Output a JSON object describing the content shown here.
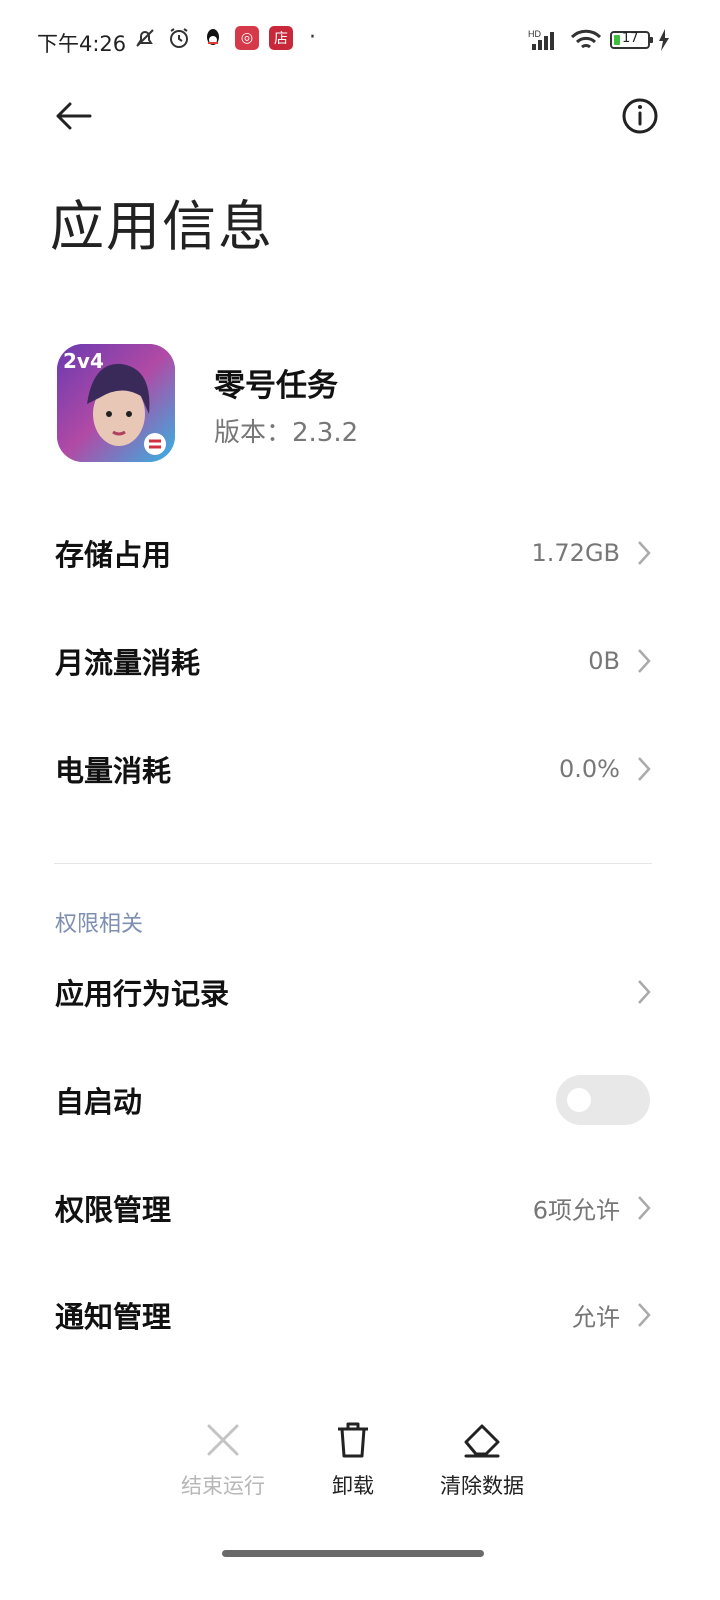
{
  "status_bar": {
    "time": "下午4:26",
    "icons": [
      "mute-bell-icon",
      "alarm-icon",
      "qq-icon",
      "app-badge-icon",
      "store-badge-icon"
    ],
    "store_badge_text": "店",
    "network": "HD",
    "battery_level": "17",
    "charging": true
  },
  "header": {
    "title": "应用信息"
  },
  "app": {
    "name": "零号任务",
    "version": "版本：2.3.2",
    "icon_text": "2v4"
  },
  "rows": {
    "storage": {
      "label": "存储占用",
      "value": "1.72GB"
    },
    "data": {
      "label": "月流量消耗",
      "value": "0B"
    },
    "battery": {
      "label": "电量消耗",
      "value": "0.0%"
    }
  },
  "permissions": {
    "section_label": "权限相关",
    "behavior": {
      "label": "应用行为记录"
    },
    "autostart": {
      "label": "自启动",
      "enabled": false
    },
    "perm_manage": {
      "label": "权限管理",
      "value": "6项允许"
    },
    "notify": {
      "label": "通知管理",
      "value": "允许"
    }
  },
  "actions": {
    "stop": "结束运行",
    "uninstall": "卸载",
    "clear": "清除数据"
  },
  "colors": {
    "section_label": "#7e8fb1",
    "toggle_off": "#e8e8e8",
    "value_text": "#777777"
  }
}
